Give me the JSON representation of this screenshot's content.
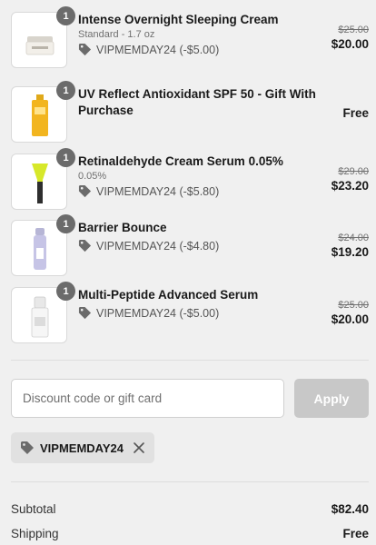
{
  "items": [
    {
      "qty": "1",
      "name": "Intense Overnight Sleeping Cream",
      "variant": "Standard - 1.7 oz",
      "discount": "VIPMEMDAY24 (-$5.00)",
      "old_price": "$25.00",
      "price": "$20.00",
      "thumb_icon": "cream-jar"
    },
    {
      "qty": "1",
      "name": "UV Reflect Antioxidant SPF 50 - Gift With Purchase",
      "price": "Free",
      "thumb_icon": "sunscreen-bottle"
    },
    {
      "qty": "1",
      "name": "Retinaldehyde Cream Serum 0.05%",
      "variant": "0.05%",
      "discount": "VIPMEMDAY24 (-$5.80)",
      "old_price": "$29.00",
      "price": "$23.20",
      "thumb_icon": "serum-tube"
    },
    {
      "qty": "1",
      "name": "Barrier Bounce",
      "discount": "VIPMEMDAY24 (-$4.80)",
      "old_price": "$24.00",
      "price": "$19.20",
      "thumb_icon": "pump-bottle"
    },
    {
      "qty": "1",
      "name": "Multi-Peptide Advanced Serum",
      "discount": "VIPMEMDAY24 (-$5.00)",
      "old_price": "$25.00",
      "price": "$20.00",
      "thumb_icon": "dropper-bottle"
    }
  ],
  "discount_form": {
    "placeholder": "Discount code or gift card",
    "value": "",
    "apply_label": "Apply"
  },
  "applied_code": {
    "code": "VIPMEMDAY24"
  },
  "summary": {
    "subtotal_label": "Subtotal",
    "subtotal_value": "$82.40",
    "shipping_label": "Shipping",
    "shipping_value": "Free"
  },
  "colors": {
    "background": "#f0f0f0",
    "qty_badge": "#6b6b6b",
    "apply_disabled": "#c8c8c8",
    "chip_bg": "#e1e1e1"
  }
}
